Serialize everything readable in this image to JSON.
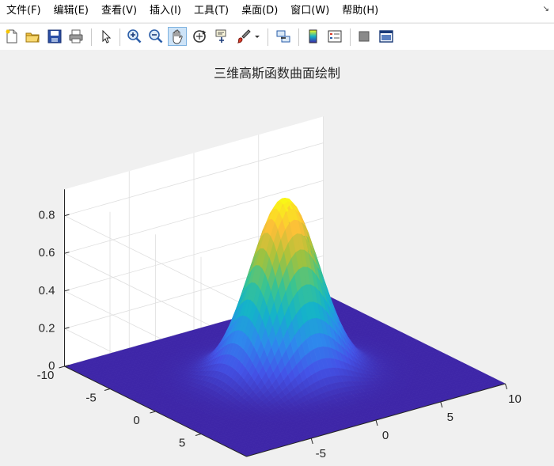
{
  "menu": {
    "items": [
      {
        "id": "file",
        "label": "文件(F)"
      },
      {
        "id": "edit",
        "label": "编辑(E)"
      },
      {
        "id": "view",
        "label": "查看(V)"
      },
      {
        "id": "insert",
        "label": "插入(I)"
      },
      {
        "id": "tools",
        "label": "工具(T)"
      },
      {
        "id": "desktop",
        "label": "桌面(D)"
      },
      {
        "id": "window",
        "label": "窗口(W)"
      },
      {
        "id": "help",
        "label": "帮助(H)"
      }
    ],
    "corner_glyph": "↘"
  },
  "toolbar": {
    "buttons": [
      {
        "name": "new-figure-icon"
      },
      {
        "name": "open-file-icon"
      },
      {
        "name": "save-icon"
      },
      {
        "name": "print-icon"
      },
      {
        "name": "edit-plot-arrow-icon"
      },
      {
        "name": "zoom-in-icon"
      },
      {
        "name": "zoom-out-icon"
      },
      {
        "name": "pan-hand-icon",
        "active": true
      },
      {
        "name": "rotate-3d-icon"
      },
      {
        "name": "data-cursor-icon"
      },
      {
        "name": "brush-icon"
      },
      {
        "name": "brush-dropdown-icon"
      },
      {
        "name": "link-plot-icon"
      },
      {
        "name": "colorbar-icon"
      },
      {
        "name": "legend-icon"
      },
      {
        "name": "hide-plot-tools-icon"
      },
      {
        "name": "show-plot-tools-icon"
      }
    ]
  },
  "chart_data": {
    "type": "surface",
    "title": "三维高斯函数曲面绘制",
    "function": "z = exp(-(x^2 + y^2) / (2 * 2.2^2)) * 0.94",
    "x_range": [
      -10,
      10
    ],
    "y_range": [
      -10,
      10
    ],
    "z_range": [
      0,
      0.94
    ],
    "x_ticks": [
      -5,
      0,
      5,
      10
    ],
    "y_ticks": [
      -10,
      -5,
      0,
      5
    ],
    "z_ticks": [
      0,
      0.2,
      0.4,
      0.6,
      0.8
    ],
    "peak": {
      "x": 0,
      "y": 0,
      "z": 0.94
    },
    "colormap": "parula",
    "colormap_stops": [
      "#3e26a8",
      "#4353e8",
      "#2d8aed",
      "#14b3c9",
      "#3cc48f",
      "#a6c23a",
      "#fcbf38",
      "#f9fb14"
    ],
    "grid": true,
    "view": {
      "azimuth": -37.5,
      "elevation": 30
    }
  }
}
